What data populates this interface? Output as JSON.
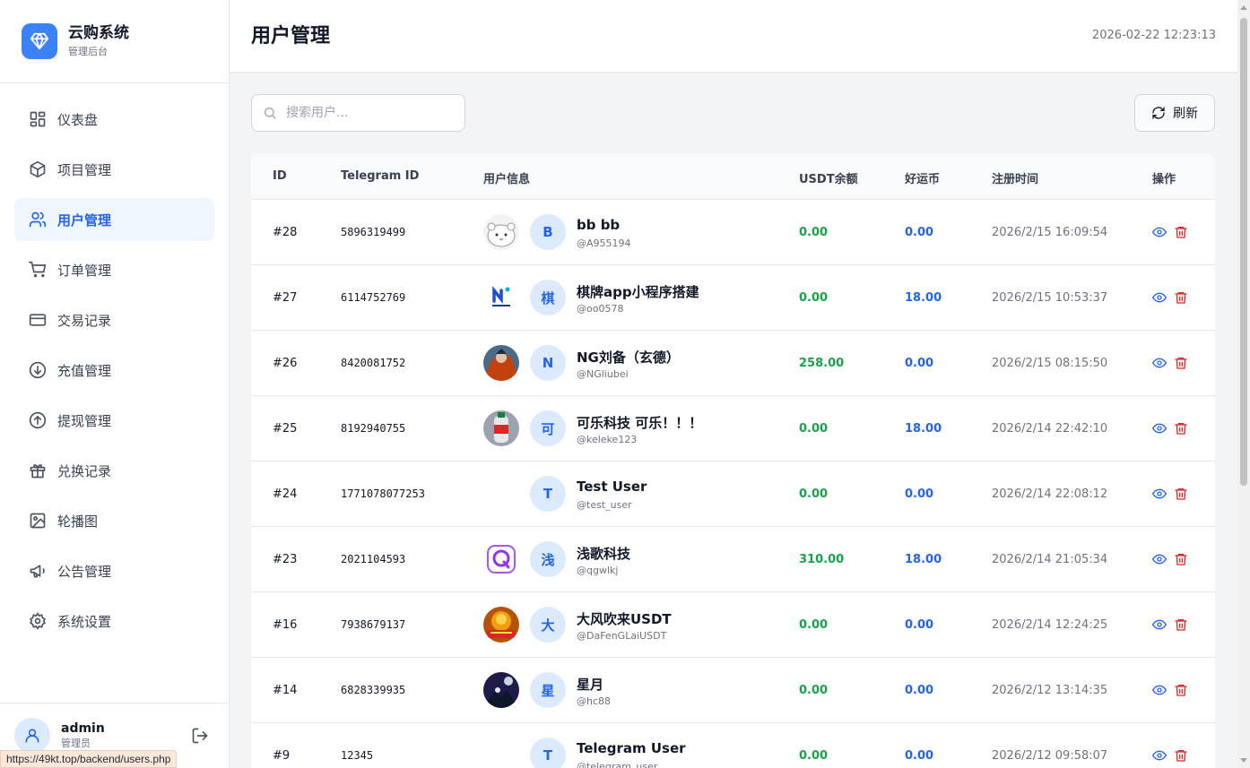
{
  "brand": {
    "name": "云购系统",
    "subtitle": "管理后台"
  },
  "sidebar": {
    "items": [
      {
        "label": "仪表盘",
        "icon": "dashboard-icon"
      },
      {
        "label": "项目管理",
        "icon": "box-icon"
      },
      {
        "label": "用户管理",
        "icon": "users-icon",
        "active": true
      },
      {
        "label": "订单管理",
        "icon": "cart-icon"
      },
      {
        "label": "交易记录",
        "icon": "card-icon"
      },
      {
        "label": "充值管理",
        "icon": "arrow-down-circle-icon"
      },
      {
        "label": "提现管理",
        "icon": "arrow-up-circle-icon"
      },
      {
        "label": "兑换记录",
        "icon": "gift-icon"
      },
      {
        "label": "轮播图",
        "icon": "image-icon"
      },
      {
        "label": "公告管理",
        "icon": "megaphone-icon"
      },
      {
        "label": "系统设置",
        "icon": "gear-icon"
      }
    ]
  },
  "user": {
    "name": "admin",
    "role": "管理员"
  },
  "status_url": "https://49kt.top/backend/users.php",
  "header": {
    "title": "用户管理",
    "datetime": "2026-02-22 12:23:13"
  },
  "toolbar": {
    "search_placeholder": "搜索用户...",
    "refresh_label": "刷新"
  },
  "table": {
    "columns": [
      "ID",
      "Telegram ID",
      "用户信息",
      "USDT余额",
      "好运币",
      "注册时间",
      "操作"
    ],
    "rows": [
      {
        "id": "#28",
        "tg": "5896319499",
        "letter": "B",
        "name": "bb bb",
        "handle": "@A955194",
        "usdt": "0.00",
        "coin": "0.00",
        "time": "2026/2/15 16:09:54"
      },
      {
        "id": "#27",
        "tg": "6114752769",
        "letter": "棋",
        "name": "棋牌app小程序搭建",
        "handle": "@oo0578",
        "usdt": "0.00",
        "coin": "18.00",
        "time": "2026/2/15 10:53:37"
      },
      {
        "id": "#26",
        "tg": "8420081752",
        "letter": "N",
        "name": "NG刘备（玄德）",
        "handle": "@NGliubei",
        "usdt": "258.00",
        "coin": "0.00",
        "time": "2026/2/15 08:15:50"
      },
      {
        "id": "#25",
        "tg": "8192940755",
        "letter": "可",
        "name": "可乐科技 可乐！！！",
        "handle": "@keleke123",
        "usdt": "0.00",
        "coin": "18.00",
        "time": "2026/2/14 22:42:10"
      },
      {
        "id": "#24",
        "tg": "1771078077253",
        "letter": "T",
        "name": "Test User",
        "handle": "@test_user",
        "usdt": "0.00",
        "coin": "0.00",
        "time": "2026/2/14 22:08:12"
      },
      {
        "id": "#23",
        "tg": "2021104593",
        "letter": "浅",
        "name": "浅歌科技",
        "handle": "@qgwlkj",
        "usdt": "310.00",
        "coin": "18.00",
        "time": "2026/2/14 21:05:34"
      },
      {
        "id": "#16",
        "tg": "7938679137",
        "letter": "大",
        "name": "大风吹来USDT",
        "handle": "@DaFenGLaiUSDT",
        "usdt": "0.00",
        "coin": "0.00",
        "time": "2026/2/14 12:24:25"
      },
      {
        "id": "#14",
        "tg": "6828339935",
        "letter": "星",
        "name": "星月",
        "handle": "@hc88",
        "usdt": "0.00",
        "coin": "0.00",
        "time": "2026/2/12 13:14:35"
      },
      {
        "id": "#9",
        "tg": "12345",
        "letter": "T",
        "name": "Telegram User",
        "handle": "@telegram_user",
        "usdt": "0.00",
        "coin": "0.00",
        "time": "2026/2/12 09:58:07"
      }
    ]
  },
  "colors": {
    "accent": "#2563eb",
    "positive": "#16a34a",
    "danger": "#dc2626"
  }
}
